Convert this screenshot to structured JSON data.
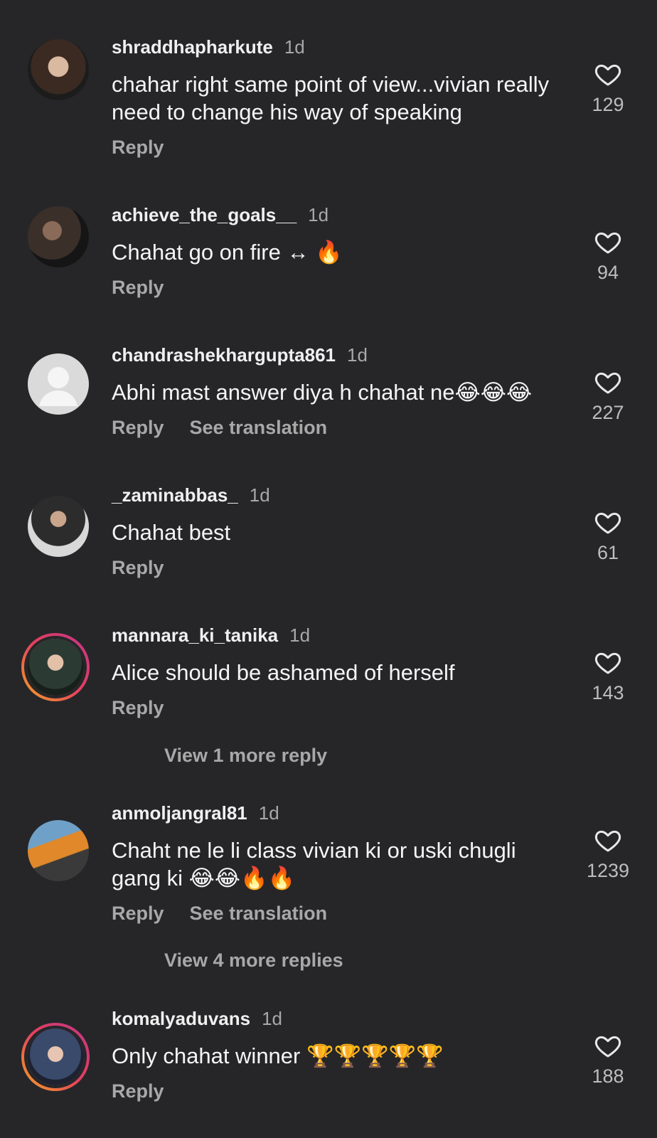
{
  "comments": [
    {
      "username": "shraddhapharkute",
      "time": "1d",
      "text": "chahar right same point of view...vivian really need to change his way of speaking",
      "reply": "Reply",
      "likes": "129"
    },
    {
      "username": "achieve_the_goals__",
      "time": "1d",
      "text": "Chahat go on fire ↔ 🔥",
      "reply": "Reply",
      "likes": "94"
    },
    {
      "username": "chandrashekhargupta861",
      "time": "1d",
      "text": "Abhi mast answer diya h chahat ne😂😂😂",
      "reply": "Reply",
      "translate": "See translation",
      "likes": "227"
    },
    {
      "username": "_zaminabbas_",
      "time": "1d",
      "text": "Chahat best",
      "reply": "Reply",
      "likes": "61"
    },
    {
      "username": "mannara_ki_tanika",
      "time": "1d",
      "text": "Alice should be ashamed of herself",
      "reply": "Reply",
      "likes": "143",
      "view_more": "View 1 more reply"
    },
    {
      "username": "anmoljangral81",
      "time": "1d",
      "text": "Chaht ne le li class vivian ki or uski chugli gang ki 😂😂🔥🔥",
      "reply": "Reply",
      "translate": "See translation",
      "likes": "1239",
      "view_more": "View 4 more replies"
    },
    {
      "username": "komalyaduvans",
      "time": "1d",
      "text": "Only chahat winner 🏆🏆🏆🏆🏆",
      "reply": "Reply",
      "likes": "188"
    }
  ],
  "icons": {
    "like": "heart-outline-icon",
    "avatar_placeholder": "default-avatar-icon"
  },
  "colors": {
    "background": "#262629",
    "secondary_text": "#a8a8a8",
    "story_ring_start": "#f5a623",
    "story_ring_end": "#c13584"
  }
}
